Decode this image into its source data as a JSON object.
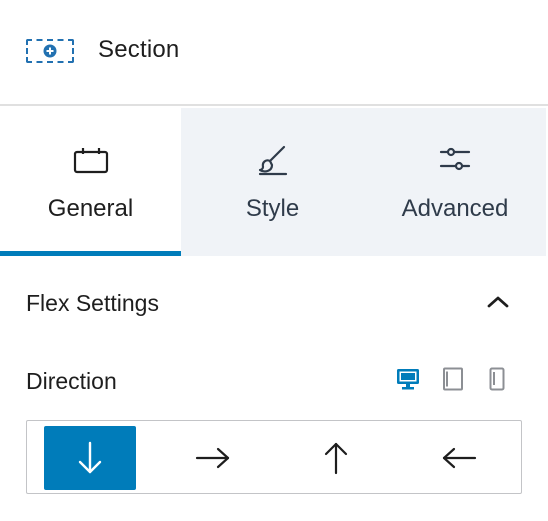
{
  "header": {
    "title": "Section",
    "icon": "section-plus-icon",
    "accent": "#2271b1"
  },
  "tabs": [
    {
      "label": "General",
      "icon": "general-icon",
      "active": true
    },
    {
      "label": "Style",
      "icon": "brush-icon",
      "active": false
    },
    {
      "label": "Advanced",
      "icon": "sliders-icon",
      "active": false
    }
  ],
  "panel": {
    "title": "Flex Settings",
    "collapse_icon": "chevron-up-icon",
    "direction": {
      "label": "Direction",
      "devices": [
        {
          "name": "desktop",
          "icon": "desktop-icon",
          "active": true
        },
        {
          "name": "tablet",
          "icon": "tablet-icon",
          "active": false
        },
        {
          "name": "mobile",
          "icon": "mobile-icon",
          "active": false
        }
      ],
      "options": [
        {
          "name": "column",
          "icon": "arrow-down-icon",
          "active": true
        },
        {
          "name": "row",
          "icon": "arrow-right-icon",
          "active": false
        },
        {
          "name": "column-reverse",
          "icon": "arrow-up-icon",
          "active": false
        },
        {
          "name": "row-reverse",
          "icon": "arrow-left-icon",
          "active": false
        }
      ]
    }
  },
  "colors": {
    "primary": "#007cba",
    "tab_inactive_bg": "#f0f3f7",
    "border": "#c3c4c7"
  }
}
